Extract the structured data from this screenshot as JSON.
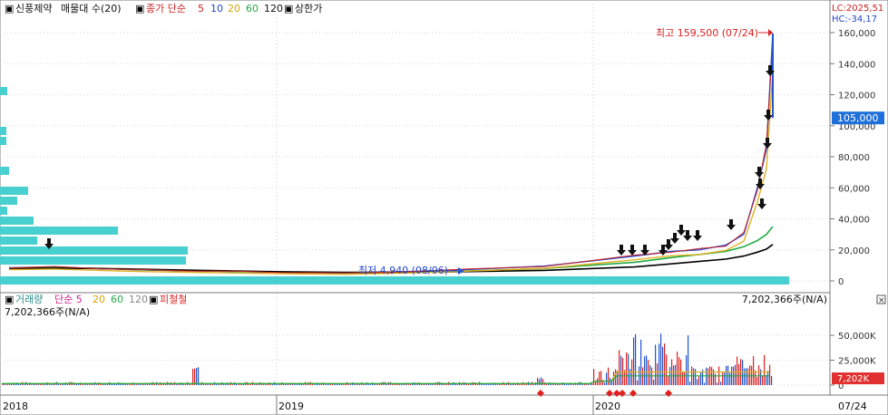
{
  "price_legend": {
    "box1": "▣",
    "name": "신풍제약",
    "indicator": "매물대 수(20)",
    "box2": "▣",
    "close_label": "종가 단순",
    "ma": [
      "5",
      "10",
      "20",
      "60",
      "120"
    ],
    "box3": "▣",
    "limit_label": "상한가"
  },
  "lc_readout": "LC:2025,51",
  "hc_readout": "HC:-34,17",
  "price_axis": {
    "ticks": [
      "160,000",
      "140,000",
      "120,000",
      "100,000",
      "80,000",
      "60,000",
      "40,000",
      "20,000",
      "0"
    ],
    "current_value": "105,000"
  },
  "annotations": {
    "high": "최고 159,500 (07/24)",
    "low": "최저 4,940 (08/06)"
  },
  "volume_legend": {
    "box1": "▣",
    "name": "거래량",
    "ma_label": "단순 5",
    "ma": [
      "20",
      "60",
      "120"
    ],
    "box2": "▣",
    "extra": "피철철"
  },
  "volume_readout_left": "7,202,366주(N/A)",
  "volume_readout_right": "7,202,366주(N/A)",
  "volume_axis": {
    "ticks": [
      "50,000K",
      "25,000K",
      "0"
    ],
    "current_value": "7,202K"
  },
  "x_axis": {
    "labels": [
      "2018",
      "2019",
      "2020"
    ],
    "cursor_date": "07/24"
  },
  "colors": {
    "bg": "#ffffff",
    "volume_profile": "#48cfcf",
    "ma5": "#cc2222",
    "ma10": "#2244cc",
    "ma20": "#e0b020",
    "ma60": "#22aa44",
    "ma120": "#000000",
    "up": "#dd2222",
    "down": "#2255cc",
    "current_tag": "#1e6fd9",
    "vol_tag": "#e03030"
  },
  "chart_data": {
    "type": "line",
    "title": "신풍제약",
    "x": [
      "2018",
      "2019",
      "2020",
      "07/24"
    ],
    "price": {
      "ylim": [
        0,
        160000
      ],
      "high": 159500,
      "low": 4940,
      "current": 105000,
      "series": [
        {
          "name": "종가",
          "values": [
            8500,
            9000,
            8000,
            7000,
            6500,
            6000,
            5500,
            5000,
            6000,
            7500,
            9500,
            16000,
            19000,
            20000,
            23000,
            30000,
            60000,
            85000,
            159500
          ]
        },
        {
          "name": "60",
          "values": [
            8200,
            8500,
            8000,
            7200,
            6600,
            6100,
            5700,
            5200,
            5600,
            6500,
            8000,
            12000,
            15000,
            17000,
            19000,
            22000,
            26000,
            30000,
            35000
          ]
        },
        {
          "name": "120",
          "values": [
            8000,
            8200,
            8000,
            7500,
            6900,
            6400,
            5900,
            5500,
            5600,
            6000,
            6800,
            9000,
            11000,
            12500,
            14000,
            16000,
            18500,
            20500,
            23500
          ]
        }
      ]
    },
    "volume": {
      "ylim": [
        0,
        70000
      ],
      "current": 7202,
      "unit": "K"
    },
    "volume_profile_rows": 20
  }
}
